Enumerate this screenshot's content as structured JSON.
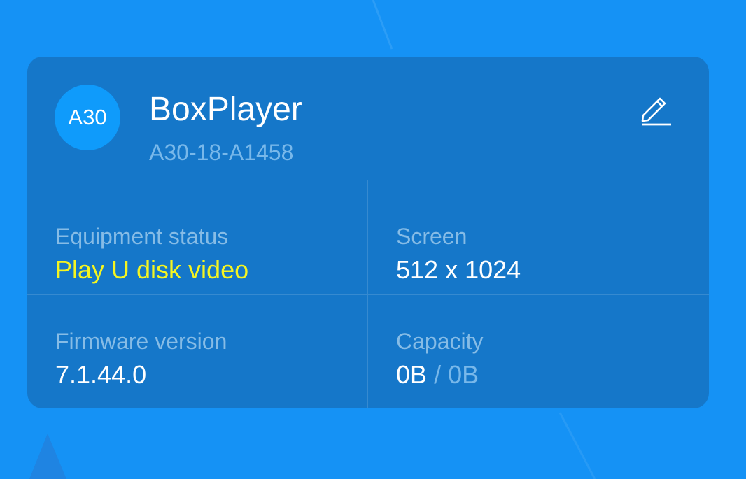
{
  "colors": {
    "background": "#1592f5",
    "card": "#1577c9",
    "avatar": "#0f9bfb",
    "status_highlight": "#f5f520",
    "muted_text": "#86bce6"
  },
  "device": {
    "avatar_text": "A30",
    "name": "BoxPlayer",
    "serial": "A30-18-A1458",
    "edit_icon": "pencil-icon"
  },
  "info": {
    "equipment_status": {
      "label": "Equipment status",
      "value": "Play U disk video"
    },
    "screen": {
      "label": "Screen",
      "value": "512 x 1024"
    },
    "firmware": {
      "label": "Firmware version",
      "value": "7.1.44.0"
    },
    "capacity": {
      "label": "Capacity",
      "used": "0B",
      "separator": "/",
      "total": "0B"
    }
  }
}
